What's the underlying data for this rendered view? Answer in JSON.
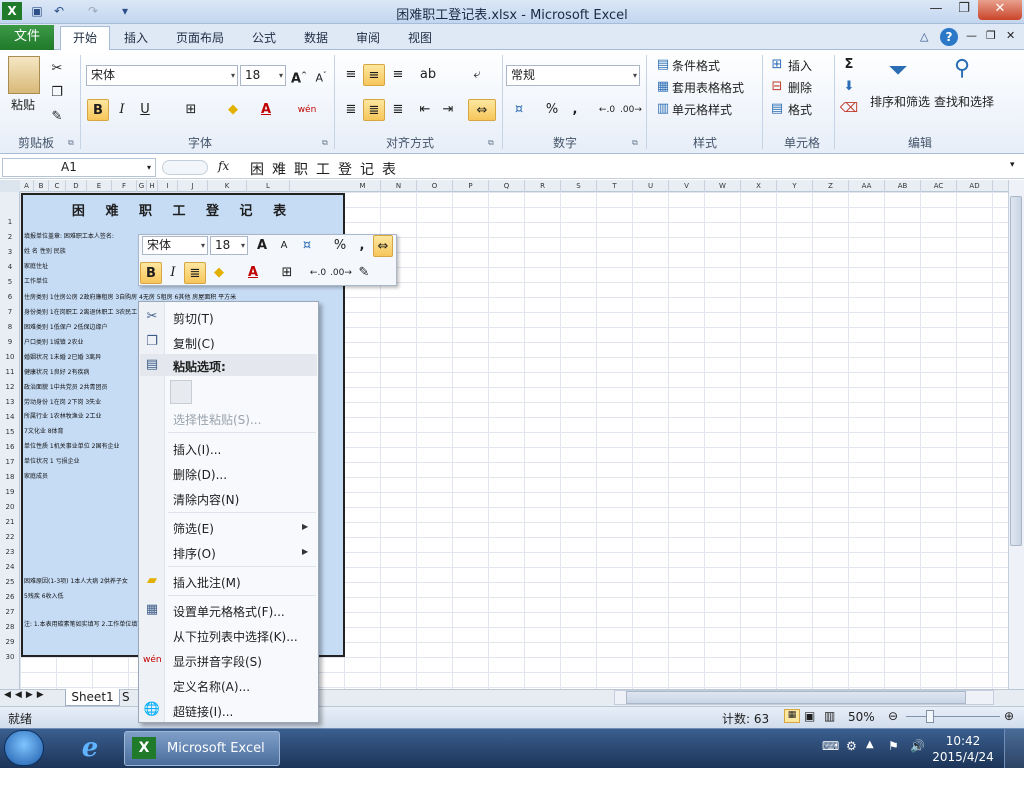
{
  "window": {
    "title": "困难职工登记表.xlsx - Microsoft Excel"
  },
  "ribbon_tabs": [
    "文件",
    "开始",
    "插入",
    "页面布局",
    "公式",
    "数据",
    "审阅",
    "视图"
  ],
  "clipboard": {
    "paste_label": "粘贴",
    "group_label": "剪贴板"
  },
  "font": {
    "name": "宋体",
    "size": "18",
    "group_label": "字体",
    "bold": "B",
    "italic": "I",
    "underline": "U",
    "font_color": "A",
    "pinyin": "wén"
  },
  "alignment": {
    "group_label": "对齐方式"
  },
  "number": {
    "format": "常规",
    "group_label": "数字",
    "percent": "%",
    "comma": ","
  },
  "styles": {
    "cond_format": "条件格式",
    "table_format": "套用表格格式",
    "cell_styles": "单元格样式",
    "group_label": "样式"
  },
  "cells": {
    "insert": "插入",
    "delete": "删除",
    "format": "格式",
    "group_label": "单元格"
  },
  "editing": {
    "sigma": "Σ",
    "sort_filter": "排序和筛选",
    "find_select": "查找和选择",
    "group_label": "编辑"
  },
  "formula_bar": {
    "name_box": "A1",
    "fx": "fx",
    "content": "困难职工登记表"
  },
  "columns_left": [
    "A",
    "B",
    "C",
    "D",
    "E",
    "F",
    "G",
    "H",
    "I",
    "J",
    "K",
    "L"
  ],
  "columns_right": [
    "M",
    "N",
    "O",
    "P",
    "Q",
    "R",
    "S",
    "T",
    "U",
    "V",
    "W",
    "X",
    "Y",
    "Z",
    "AA",
    "AB",
    "AC",
    "AD"
  ],
  "rows": [
    "1",
    "2",
    "3",
    "4",
    "5",
    "6",
    "7",
    "8",
    "9",
    "10",
    "11",
    "12",
    "13",
    "14",
    "15",
    "16",
    "17",
    "18",
    "19",
    "20",
    "21",
    "22",
    "23",
    "24",
    "25",
    "26",
    "27",
    "28",
    "29",
    "30"
  ],
  "form": {
    "title": "困 难 职 工 登 记 表",
    "lines": [
      "填报单位盖章:     困难职工本人签名:",
      "姓  名       性别     民族",
      "家庭住址",
      "工作单位",
      "住房类别  1住房公房  2政府廉租房  3自购房  4无房  5租房  6其他    房屋面积      平方米",
      "身份类别  1在岗职工  2离退休职工  3农民工",
      "困难类别  1低保户  2低保边缘户",
      "户口类别  1城镇  2农业",
      "婚姻状况  1未婚  2已婚  3离异",
      "健康状况  1良好  2有疾病",
      "政治面貌  1中共党员  2共青团员",
      "劳动身份  1在岗  2下岗  3失业",
      "所属行业  1农林牧渔业  2工业",
      "             7文化业  8体育",
      "单位性质  1机关事业单位  2国有企业",
      "单位状况  1  亏损企业",
      "家庭成员",
      "困难原因(1-3项)  1本人大病  2供养子女",
      "             5残疾  6收入低",
      "注:  1.本表用碳素笔如实填写  2.工作单位填写全称  3.《身份证》复印件"
    ]
  },
  "mini_toolbar": {
    "font": "宋体",
    "size": "18",
    "percent": "%",
    "comma": ",",
    "bold": "B",
    "italic": "I",
    "font_color": "A"
  },
  "context_menu": {
    "cut": "剪切(T)",
    "copy": "复制(C)",
    "paste_options": "粘贴选项:",
    "paste_special": "选择性粘贴(S)...",
    "insert": "插入(I)...",
    "delete": "删除(D)...",
    "clear": "清除内容(N)",
    "filter": "筛选(E)",
    "sort": "排序(O)",
    "insert_comment": "插入批注(M)",
    "format_cells": "设置单元格格式(F)...",
    "pick_list": "从下拉列表中选择(K)...",
    "phonetic": "显示拼音字段(S)",
    "define_name": "定义名称(A)...",
    "hyperlink": "超链接(I)..."
  },
  "sheet_tabs": [
    "Sheet1",
    "S"
  ],
  "status": {
    "ready": "就绪",
    "count": "计数: 63",
    "zoom": "50%"
  },
  "taskbar": {
    "excel_label": "Microsoft Excel ...",
    "time": "10:42",
    "date": "2015/4/24"
  }
}
